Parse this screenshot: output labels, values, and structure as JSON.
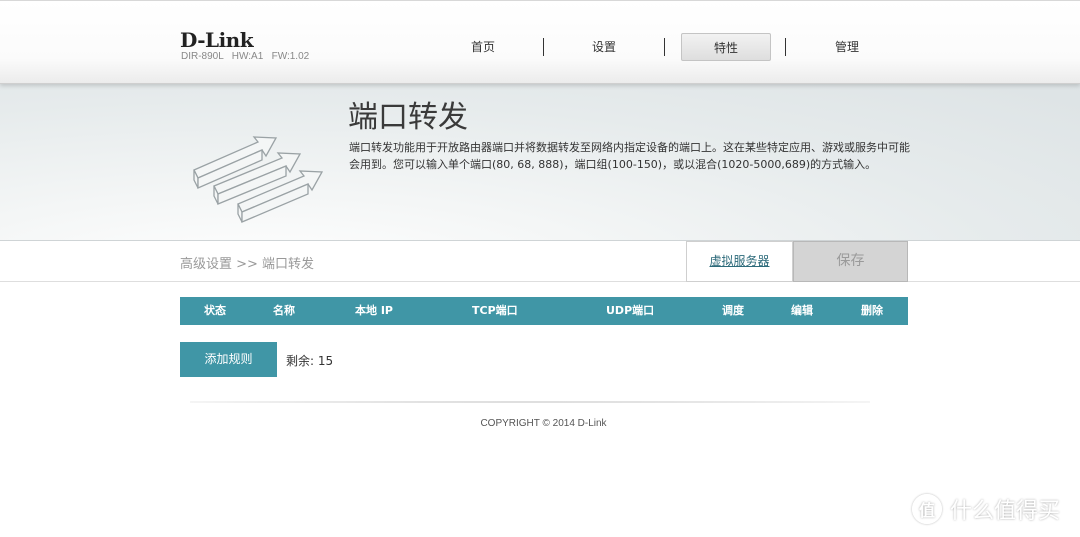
{
  "header": {
    "logo": "D-Link",
    "device_info": "DIR-890L   HW:A1   FW:1.02",
    "nav": [
      {
        "label": "首页",
        "active": false
      },
      {
        "label": "设置",
        "active": false
      },
      {
        "label": "特性",
        "active": true
      },
      {
        "label": "管理",
        "active": false
      }
    ]
  },
  "banner": {
    "title": "端口转发",
    "description": "端口转发功能用于开放路由器端口并将数据转发至网络内指定设备的端口上。这在某些特定应用、游戏或服务中可能会用到。您可以输入单个端口(80, 68, 888)，端口组(100-150)，或以混合(1020-5000,689)的方式输入。"
  },
  "subbar": {
    "breadcrumb": "高级设置 >> 端口转发",
    "virtual_server_label": "虚拟服务器",
    "save_label": "保存"
  },
  "table": {
    "columns": [
      "状态",
      "名称",
      "本地 IP",
      "TCP端口",
      "UDP端口",
      "调度",
      "编辑",
      "删除"
    ]
  },
  "add_rule_label": "添加规则",
  "remaining": "剩余: 15",
  "copyright": "COPYRIGHT © 2014 D-Link",
  "watermark": "什么值得买",
  "colors": {
    "accent": "#4096a6",
    "save_disabled": "#d4d4d4"
  }
}
